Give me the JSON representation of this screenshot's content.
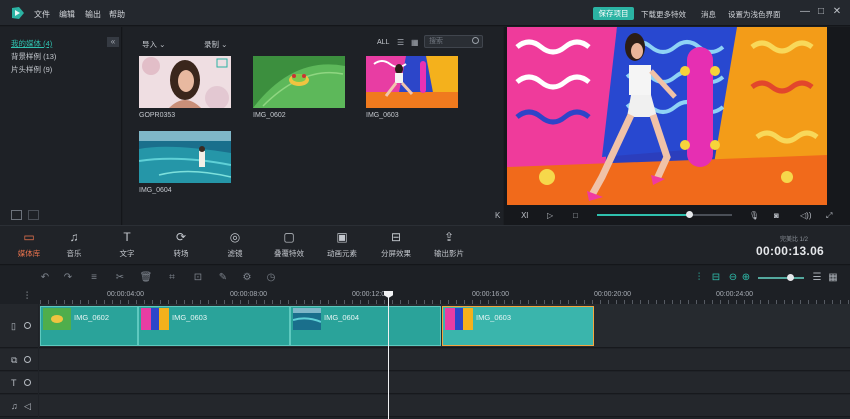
{
  "menu": [
    "文件",
    "编辑",
    "输出",
    "帮助"
  ],
  "titlebar": {
    "save_label": "保存项目",
    "download_label": "下载更多特效",
    "message_label": "消息",
    "dark_ui_label": "设置为浅色界面"
  },
  "library": {
    "items": [
      {
        "label": "我的媒体 (4)",
        "active": true
      },
      {
        "label": "背景样例 (13)",
        "active": false
      },
      {
        "label": "片头样例 (9)",
        "active": false
      }
    ]
  },
  "media": {
    "import_label": "导入",
    "record_label": "录制",
    "filter_all": "ALL",
    "search_placeholder": "搜索",
    "items": [
      {
        "name": "GOPR0353"
      },
      {
        "name": "IMG_0602"
      },
      {
        "name": "IMG_0603"
      },
      {
        "name": "IMG_0604"
      }
    ]
  },
  "effects": {
    "items": [
      {
        "label": "媒体库",
        "icon": "folder-icon",
        "active": true
      },
      {
        "label": "音乐",
        "icon": "music-icon",
        "active": false
      },
      {
        "label": "文字",
        "icon": "text-icon",
        "active": false
      },
      {
        "label": "转场",
        "icon": "transition-icon",
        "active": false
      },
      {
        "label": "滤镜",
        "icon": "filter-icon",
        "active": false
      },
      {
        "label": "叠覆特效",
        "icon": "overlay-icon",
        "active": false
      },
      {
        "label": "动画元素",
        "icon": "element-icon",
        "active": false
      },
      {
        "label": "分屏效果",
        "icon": "split-screen-icon",
        "active": false
      },
      {
        "label": "输出影片",
        "icon": "export-icon",
        "active": false
      }
    ]
  },
  "timecode": {
    "label": "完美比  1/2",
    "value": "00:00:13.06"
  },
  "preview": {
    "progress": 0.68
  },
  "timeline": {
    "ruler": [
      "00:00:04:00",
      "00:00:08:00",
      "00:00:12:00",
      "00:00:16:00",
      "00:00:20:00",
      "00:00:24:00"
    ],
    "clips": [
      {
        "name": "IMG_0602",
        "selected": false
      },
      {
        "name": "IMG_0603",
        "selected": false
      },
      {
        "name": "IMG_0604",
        "selected": false
      },
      {
        "name": "IMG_0603",
        "selected": true
      }
    ]
  },
  "colors": {
    "accent": "#2bb3a3",
    "active_tab": "#e9734e",
    "clip": "#2aa39a"
  }
}
